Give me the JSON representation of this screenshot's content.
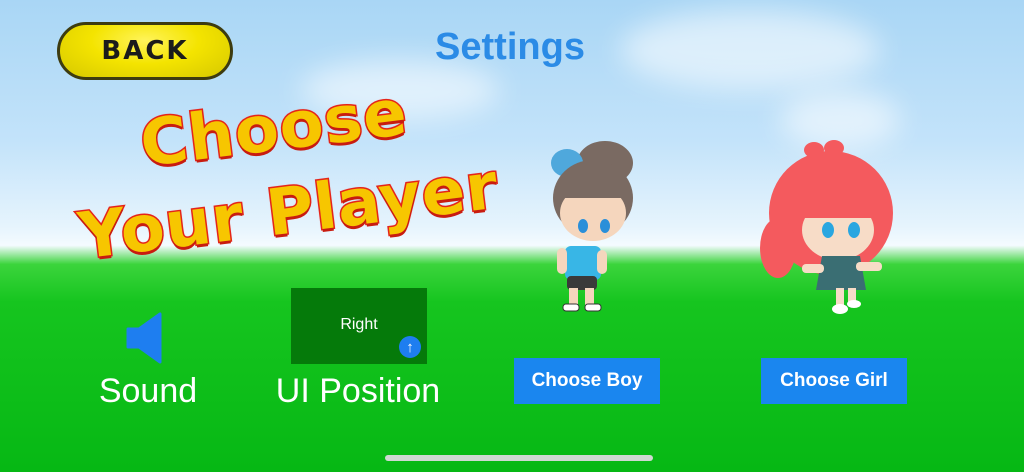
{
  "header": {
    "back_label": "BACK",
    "title": "Settings"
  },
  "headline": {
    "line1": "Choose",
    "line2": "Your Player"
  },
  "sound": {
    "label": "Sound",
    "icon": "speaker-icon"
  },
  "ui_position": {
    "label": "UI Position",
    "value": "Right",
    "icon": "arrow-up-circle-icon"
  },
  "characters": {
    "boy_button": "Choose Boy",
    "girl_button": "Choose Girl"
  },
  "colors": {
    "accent_blue": "#1a86ef",
    "title_blue": "#2b8be6",
    "back_yellow": "#f4e400",
    "ground_green": "#16c51f",
    "ui_box_green": "#057a0a"
  }
}
